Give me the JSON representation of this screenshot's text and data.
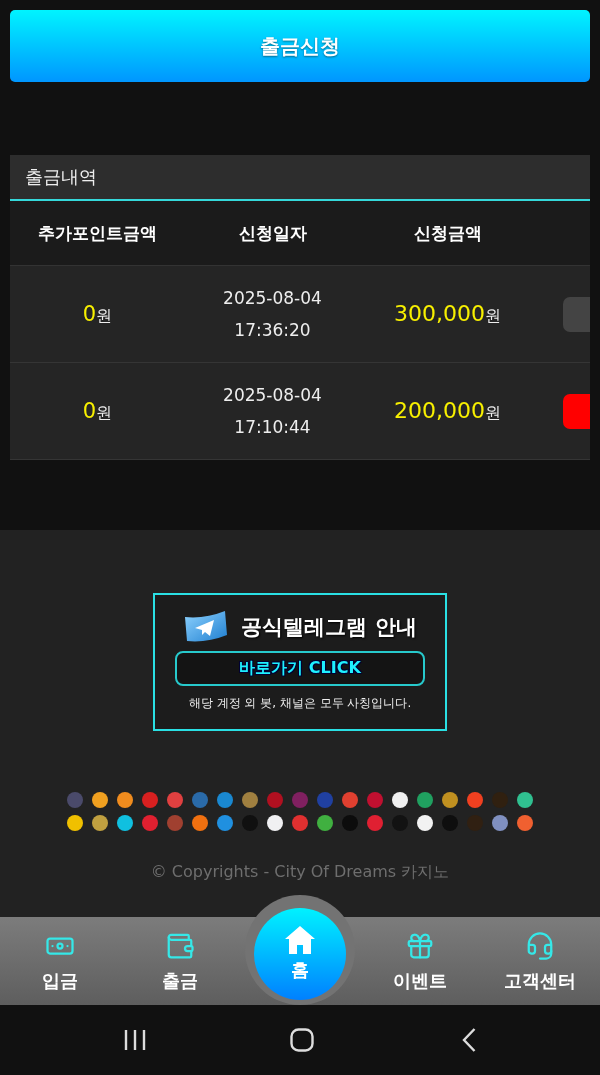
{
  "withdraw_button": {
    "label": "출금신청"
  },
  "history": {
    "title": "출금내역",
    "columns": [
      "추가포인트금액",
      "신청일자",
      "신청금액"
    ],
    "rows": [
      {
        "points": "0",
        "points_unit": "원",
        "date": "2025-08-04",
        "time": "17:36:20",
        "amount": "300,000",
        "amount_unit": "원",
        "status_button": {
          "color": "#444444"
        }
      },
      {
        "points": "0",
        "points_unit": "원",
        "date": "2025-08-04",
        "time": "17:10:44",
        "amount": "200,000",
        "amount_unit": "원",
        "status_button": {
          "color": "#ff0000"
        }
      }
    ]
  },
  "telegram_banner": {
    "title": "공식텔레그램 안내",
    "link": "바로가기 CLICK",
    "notice": "해당 계정 외 봇, 채널은 모두 사칭입니다."
  },
  "providers": [
    {
      "color": "#4a4a6a"
    },
    {
      "color": "#f0a020"
    },
    {
      "color": "#f08c1e"
    },
    {
      "color": "#d82020"
    },
    {
      "color": "#e04040"
    },
    {
      "color": "#2a6aa8"
    },
    {
      "color": "#1a88d0"
    },
    {
      "color": "#a08040"
    },
    {
      "color": "#b01020"
    },
    {
      "color": "#802060"
    },
    {
      "color": "#2040a0"
    },
    {
      "color": "#e04030"
    },
    {
      "color": "#c01030"
    },
    {
      "color": "#f0f0f0"
    },
    {
      "color": "#20a060"
    },
    {
      "color": "#c09020"
    },
    {
      "color": "#f04020"
    },
    {
      "color": "#302010"
    },
    {
      "color": "#30c090"
    },
    {
      "color": "#f0c000"
    },
    {
      "color": "#c0a040"
    },
    {
      "color": "#10c0e0"
    },
    {
      "color": "#e02030"
    },
    {
      "color": "#a04030"
    },
    {
      "color": "#f07010"
    },
    {
      "color": "#2090e0"
    },
    {
      "color": "#101010"
    },
    {
      "color": "#f0f0f2"
    },
    {
      "color": "#e03030"
    },
    {
      "color": "#40b040"
    },
    {
      "color": "#0c0c0c"
    },
    {
      "color": "#e02032"
    },
    {
      "color": "#121212"
    },
    {
      "color": "#f2f2f2"
    },
    {
      "color": "#0e0e0e"
    },
    {
      "color": "#302012"
    },
    {
      "color": "#8090c0"
    },
    {
      "color": "#f06030"
    }
  ],
  "copyright": "© Copyrights - City Of Dreams 카지노",
  "bottom_nav": [
    {
      "label": "입금",
      "kind": "tab"
    },
    {
      "label": "출금",
      "kind": "tab"
    },
    {
      "label": "홈",
      "kind": "center"
    },
    {
      "label": "이벤트",
      "kind": "tab"
    },
    {
      "label": "고객센터",
      "kind": "tab"
    }
  ]
}
